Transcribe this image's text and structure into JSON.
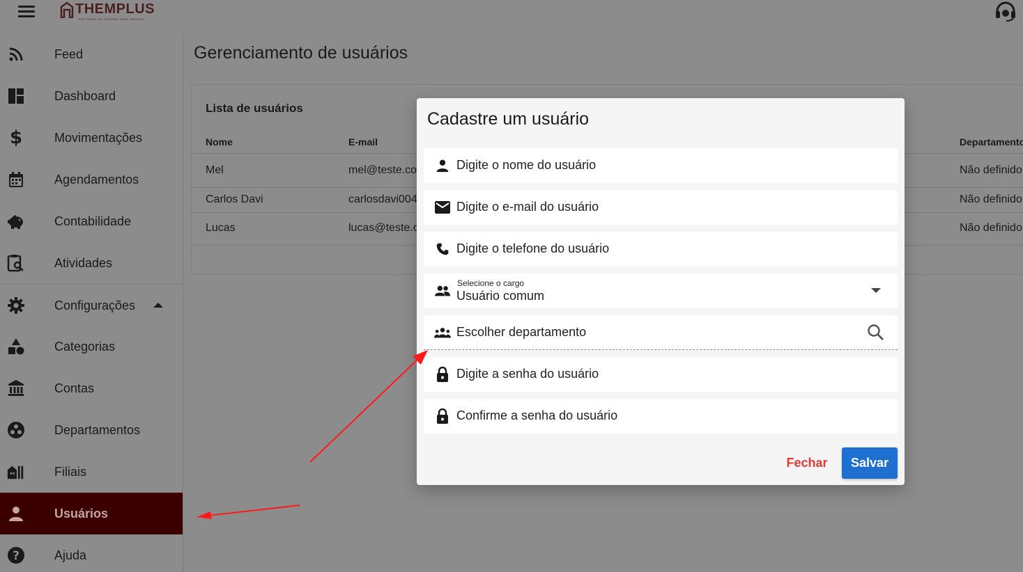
{
  "header": {
    "logo_text": "THEMPLUS",
    "logo_subtext": "SOFTWARE DE GESTÃO PARA IGREJAS",
    "menu_icon": "menu-icon",
    "support_icon": "headset-icon"
  },
  "sidebar": {
    "items": [
      {
        "label": "Feed",
        "icon": "rss-icon"
      },
      {
        "label": "Dashboard",
        "icon": "dashboard-icon"
      },
      {
        "label": "Movimentações",
        "icon": "dollar-icon"
      },
      {
        "label": "Agendamentos",
        "icon": "calendar-icon"
      },
      {
        "label": "Contabilidade",
        "icon": "piggy-bank-icon"
      },
      {
        "label": "Atividades",
        "icon": "clipboard-search-icon"
      },
      {
        "label": "Configurações",
        "icon": "gear-icon"
      },
      {
        "label": "Categorias",
        "icon": "category-icon"
      },
      {
        "label": "Contas",
        "icon": "bank-icon"
      },
      {
        "label": "Departamentos",
        "icon": "workspaces-icon"
      },
      {
        "label": "Filiais",
        "icon": "buildings-icon"
      },
      {
        "label": "Usuários",
        "icon": "person-icon"
      },
      {
        "label": "Ajuda",
        "icon": "help-icon"
      }
    ],
    "active": "Usuários"
  },
  "main": {
    "page_title": "Gerenciamento de usuários",
    "card_title": "Lista de usuários",
    "columns": [
      "Nome",
      "E-mail",
      "Departamento"
    ],
    "rows": [
      {
        "nome": "Mel",
        "email": "mel@teste.co",
        "departamento": "Não definido"
      },
      {
        "nome": "Carlos Davi",
        "email": "carlosdavi004",
        "departamento": "Não definido"
      },
      {
        "nome": "Lucas",
        "email": "lucas@teste.c",
        "departamento": "Não definido"
      }
    ]
  },
  "dialog": {
    "title": "Cadastre um usuário",
    "fields": {
      "name_placeholder": "Digite o nome do usuário",
      "email_placeholder": "Digite o e-mail do usuário",
      "phone_placeholder": "Digite o telefone do usuário",
      "role_label": "Selecione o cargo",
      "role_value": "Usuário comum",
      "department_placeholder": "Escolher departamento",
      "password_placeholder": "Digite a senha do usuário",
      "confirm_password_placeholder": "Confirme a senha do usuário"
    },
    "buttons": {
      "close": "Fechar",
      "save": "Salvar"
    }
  },
  "colors": {
    "active_nav_bg": "#3b0000",
    "save_button": "#1e6fd0",
    "close_button_text": "#e53935",
    "annotation_arrow": "#ff1a1a"
  }
}
